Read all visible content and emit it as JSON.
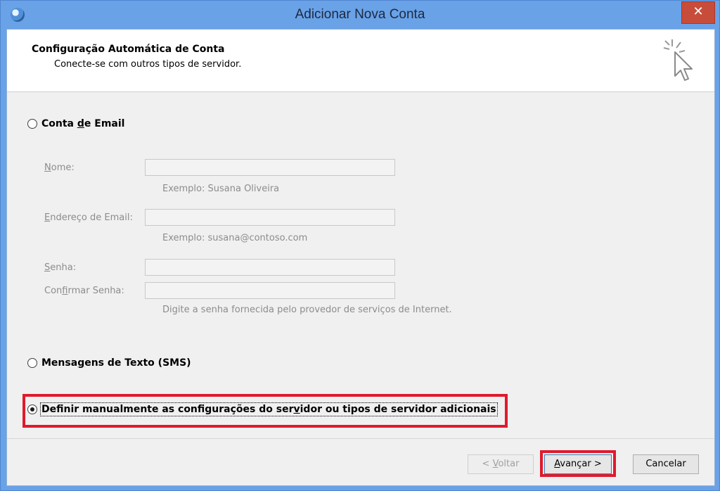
{
  "window": {
    "title": "Adicionar Nova Conta",
    "close_label": "✕"
  },
  "header": {
    "title": "Configuração Automática de Conta",
    "subtitle": "Conecte-se com outros tipos de servidor."
  },
  "options": {
    "email_account": {
      "label_pre": "Conta ",
      "label_u": "d",
      "label_post": "e Email",
      "checked": false
    },
    "sms": {
      "label_pre": "Mensa",
      "label_u": "g",
      "label_post": "ens de Texto (SMS)",
      "checked": false
    },
    "manual": {
      "label_pre": "Definir manualmente as configurações do ser",
      "label_u": "v",
      "label_post": "idor ou tipos de servidor adicionais",
      "checked": true
    }
  },
  "form": {
    "name_label_u": "N",
    "name_label_rest": "ome:",
    "name_hint": "Exemplo: Susana Oliveira",
    "email_label_u": "E",
    "email_label_rest": "ndereço de Email:",
    "email_hint": "Exemplo: susana@contoso.com",
    "password_label_u": "S",
    "password_label_rest": "enha:",
    "confirm_label_pre": "Con",
    "confirm_label_u": "f",
    "confirm_label_post": "irmar Senha:",
    "password_hint": "Digite a senha fornecida pelo provedor de serviços de Internet."
  },
  "buttons": {
    "back_pre": "< ",
    "back_u": "V",
    "back_post": "oltar",
    "next_u": "A",
    "next_post": "vançar >",
    "cancel": "Cancelar"
  },
  "colors": {
    "highlight": "#e01a2c",
    "titlebar": "#6aa2e8",
    "close": "#c74d3a"
  }
}
